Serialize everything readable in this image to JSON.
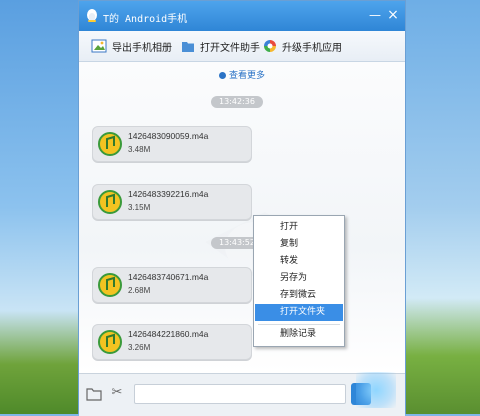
{
  "window": {
    "title": "T的 Android手机",
    "minimize_label": "—",
    "close_label": "×"
  },
  "toolbar": {
    "export_label": "导出手机相册",
    "open_folder_label": "打开文件助手",
    "upgrade_label": "升级手机应用"
  },
  "chat": {
    "view_more": "查看更多",
    "times": [
      "13:42:36",
      "13:43:52"
    ],
    "files": [
      {
        "name": "1426483090059.m4a",
        "size": "3.48M"
      },
      {
        "name": "1426483392216.m4a",
        "size": "3.15M"
      },
      {
        "name": "1426483740671.m4a",
        "size": "2.68M"
      },
      {
        "name": "1426484221860.m4a",
        "size": "3.26M"
      }
    ]
  },
  "context_menu": {
    "items": [
      "打开",
      "复制",
      "转发",
      "另存为",
      "存到微云",
      "打开文件夹",
      "删除记录"
    ],
    "highlighted": "打开文件夹"
  },
  "input": {
    "placeholder": ""
  },
  "colors": {
    "titlebar": "#2f86d6",
    "accent": "#3a8ee6",
    "bubble": "#e6e8eb"
  }
}
